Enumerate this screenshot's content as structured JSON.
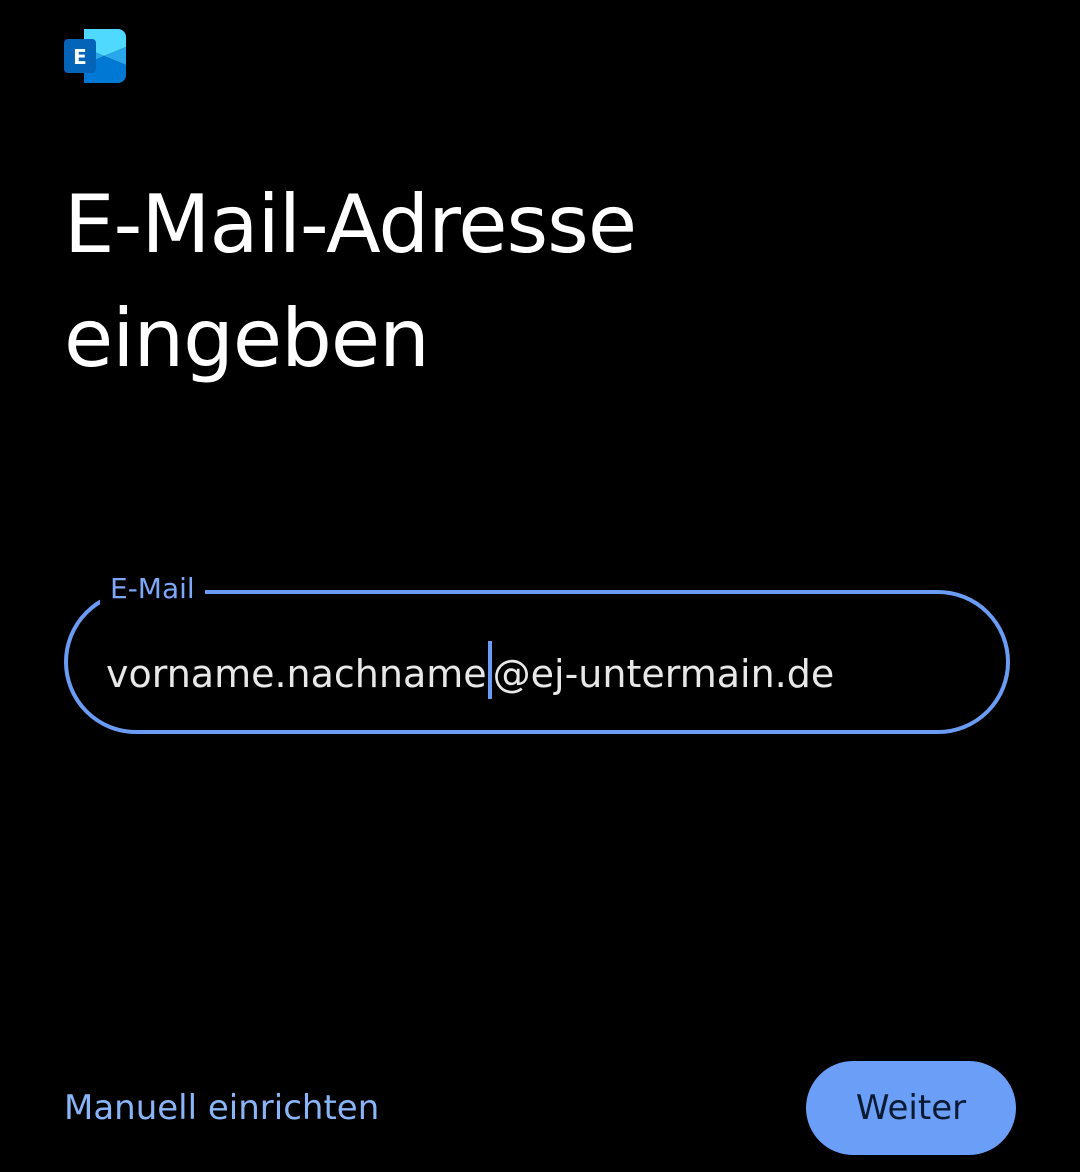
{
  "app": {
    "logo_icon": "exchange-logo-icon",
    "logo_letter": "E",
    "logo_colors": {
      "light": "#50d9ff",
      "mid": "#28a8ea",
      "dark": "#0078d4",
      "tile": "#0364b8"
    }
  },
  "header": {
    "title": "E-Mail-Adresse eingeben"
  },
  "email_field": {
    "label": "E-Mail",
    "value_before_cursor": "vorname.nachname",
    "value_after_cursor": "@ej-untermain.de",
    "border_color": "#6b9cf5"
  },
  "footer": {
    "manual_setup_label": "Manuell einrichten",
    "next_label": "Weiter",
    "accent_color": "#8ab4f8",
    "button_color": "#6b9ff7"
  }
}
